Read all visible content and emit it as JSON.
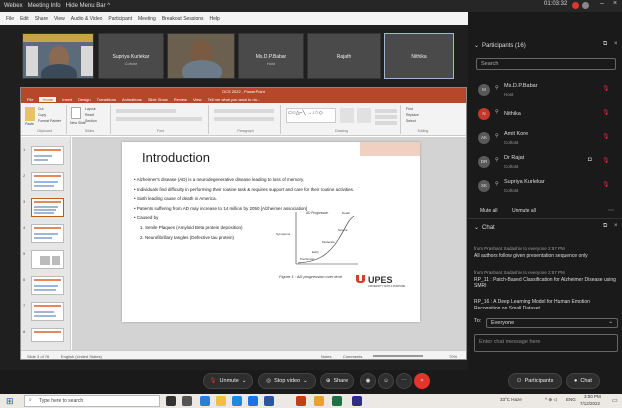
{
  "topbar": {
    "items": [
      "Webex",
      "Meeting Info",
      "Hide Menu Bar ^"
    ],
    "timer": "01:03:32"
  },
  "menubar": [
    "File",
    "Edit",
    "Share",
    "View",
    "Audio & Video",
    "Participant",
    "Meeting",
    "Breakout Sessions",
    "Help"
  ],
  "video_tiles": [
    {
      "name": "",
      "role": ""
    },
    {
      "name": "Supriya Kurlekar",
      "role": "Cohost"
    },
    {
      "name": "",
      "role": ""
    },
    {
      "name": "Ms.D.P.Babar",
      "role": "Host"
    },
    {
      "name": "Rajath",
      "role": ""
    },
    {
      "name": "Nithika",
      "role": ""
    }
  ],
  "ppt": {
    "title": "DCS 2022 - PowerPoint",
    "tabs": [
      "File",
      "Home",
      "Insert",
      "Design",
      "Transitions",
      "Animations",
      "Slide Show",
      "Review",
      "View",
      "Tell me what you want to do..."
    ],
    "ribbon_groups": [
      "Clipboard",
      "Slides",
      "Font",
      "Paragraph",
      "Drawing",
      "Editing"
    ],
    "ribbon_items": {
      "cut": "Cut",
      "copy": "Copy",
      "format_painter": "Format Painter",
      "paste": "Paste",
      "new_slide": "New Slide",
      "layout": "Layout",
      "reset": "Reset",
      "section": "Section",
      "find": "Find",
      "replace": "Replace",
      "select": "Select"
    },
    "slide": {
      "title": "Introduction",
      "bullets": [
        "Alzheimer's disease (AD) is a neurodegenerative disease leading to loss of memory.",
        "Individuals find difficulty in performing their routine task & requires support and care for their routine activities.",
        "Sixth leading cause of death in America.",
        "Patients suffering from AD may increase to 14 million by 2050 [Alzheimer association]",
        "Caused by"
      ],
      "sub_bullets": [
        "1.  Senile Plaques (Amyloid Beta protein deposition)",
        "2.  Neurofibrillary tangles (Defective tau protein)"
      ],
      "graph_labels": {
        "title": "AD Progression",
        "y": "Symptoms",
        "death": "Death",
        "severe": "Severe",
        "moderate": "Moderate",
        "early": "Early",
        "preclinical": "Preclinical"
      },
      "figure_caption": "Figure 1 : AD progression over time",
      "logo": "UPES",
      "logo_sub": "UNIVERSITY WITH A PURPOSE"
    },
    "status": {
      "slide": "Slide 3 of 76",
      "lang": "English (United States)",
      "notes": "Notes",
      "comments": "Comments",
      "zoom": "70%"
    }
  },
  "participants": {
    "header": "Participants (16)",
    "search_placeholder": "Search",
    "list": [
      {
        "initials": "M",
        "name": "Ms.D.P.Babar",
        "role": "Host",
        "accent": "#7a7a7a"
      },
      {
        "initials": "N",
        "name": "Nithika",
        "role": "",
        "accent": "#c0392b"
      },
      {
        "initials": "AK",
        "name": "Amit Kore",
        "role": "Cohost",
        "accent": "#595959"
      },
      {
        "initials": "DR",
        "name": "Dr Rajat",
        "role": "Cohost",
        "accent": "#595959"
      },
      {
        "initials": "SK",
        "name": "Supriya Kurlekar",
        "role": "Cohost",
        "accent": "#595959"
      }
    ],
    "mute_all": "Mute all",
    "unmute_all": "Unmute all"
  },
  "chat": {
    "header": "Chat",
    "messages": [
      {
        "from": "from Prashant Sadashiv to everyone   2:57 PM",
        "text": "All authors follow given presentation sequence only"
      },
      {
        "from": "from Prashant Sadashiv to everyone   2:57 PM",
        "text": "RP_11 : Patch-Based Classification for Alzheimer Disease using SMRI"
      },
      {
        "from": "",
        "text": "RP_16 : A Deep Learning Model for Human Emotion Recognition on Small Dataset"
      }
    ],
    "to_label": "To:",
    "to_value": "Everyone",
    "input_placeholder": "Enter chat message here"
  },
  "controls": {
    "unmute": "Unmute",
    "stop_video": "Stop video",
    "share": "Share",
    "participants": "Participants",
    "chat": "Chat"
  },
  "taskbar": {
    "search_placeholder": "Type here to search",
    "weather": "33°C Haze",
    "lang": "ENG",
    "time": "3:00 PM",
    "date": "7/12/2022"
  }
}
